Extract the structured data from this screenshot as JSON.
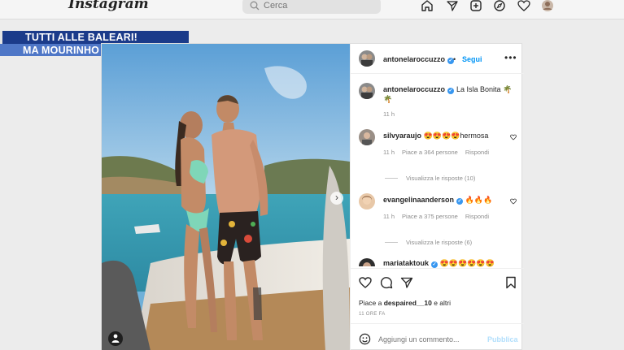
{
  "nav": {
    "logo": "Instagram",
    "search_placeholder": "Cerca",
    "icons": [
      "home-icon",
      "direct-icon",
      "new-post-icon",
      "explore-icon",
      "activity-heart-icon",
      "profile-avatar"
    ]
  },
  "banner": {
    "line1": "TUTTI ALLE BALEARI!",
    "line2": "MA MOURINHO FA IL SAFARI",
    "colors": {
      "line1_bg": "#1b3b8a",
      "line2_bg": "#4f77c7"
    }
  },
  "post": {
    "author": "antonelaroccuzzo",
    "separator": "•",
    "follow_label": "Segui",
    "more_label": "•••",
    "caption": {
      "user": "antonelaroccuzzo",
      "text": "La Isla Bonita",
      "emoji": [
        "palm-tree",
        "palm-tree"
      ],
      "time": "11 h"
    },
    "comments": [
      {
        "user": "silvyaraujo",
        "text": "hermosa",
        "emoji": [
          "heart-eyes",
          "heart-eyes",
          "heart-eyes",
          "heart-eyes"
        ],
        "time": "11 h",
        "likes": "Piace a 364 persone",
        "reply": "Rispondi",
        "replies": "Visualizza le risposte (10)"
      },
      {
        "user": "evangelinaanderson",
        "text": "",
        "emoji": [
          "fire",
          "fire",
          "fire"
        ],
        "time": "11 h",
        "likes": "Piace a 375 persone",
        "reply": "Rispondi",
        "replies": "Visualizza le risposte (6)"
      },
      {
        "user": "mariataktouk",
        "text": "",
        "emoji": [
          "heart-eyes",
          "heart-eyes",
          "heart-eyes",
          "heart-eyes",
          "heart-eyes",
          "heart-eyes"
        ]
      }
    ],
    "likes_prefix": "Piace a",
    "likes_user": "despaired__10",
    "likes_suffix": "e altri",
    "posted": "11 ORE FA",
    "add_comment_placeholder": "Aggiungi un commento...",
    "publish_label": "Pubblica",
    "accent": "#0095f6"
  }
}
